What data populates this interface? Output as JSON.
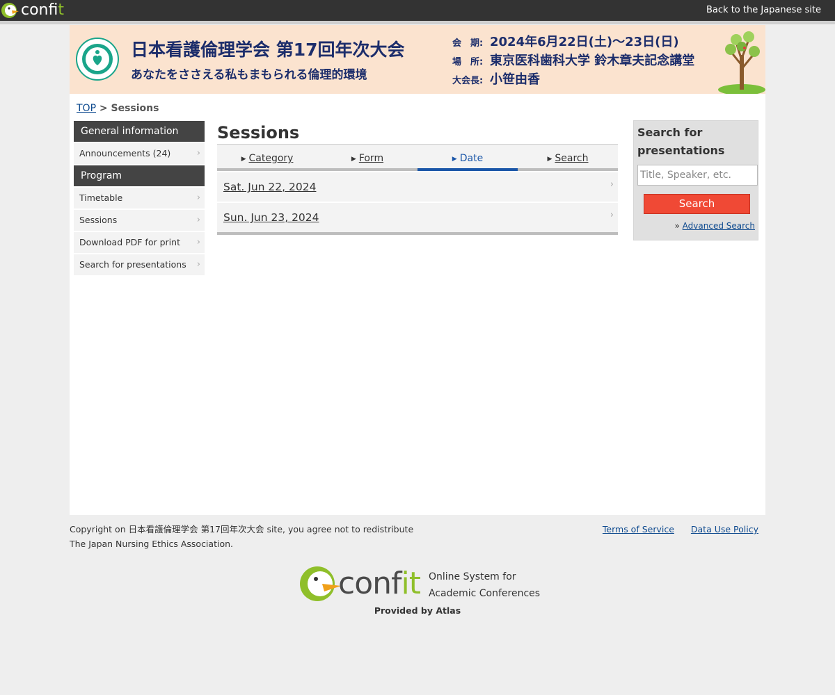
{
  "topbar": {
    "logo_text_prefix": "conf",
    "logo_text_suffix": "it",
    "back_link": "Back to the Japanese site"
  },
  "banner": {
    "title": "日本看護倫理学会 第17回年次大会",
    "subtitle": "あなたをささえる私もまもられる倫理的環境",
    "info": [
      {
        "label": "会　期:",
        "value": "2024年6月22日(土)〜23日(日)"
      },
      {
        "label": "場　所:",
        "value": "東京医科歯科大学 鈴木章夫記念講堂"
      },
      {
        "label": "大会長:",
        "value": "小笹由香"
      }
    ]
  },
  "breadcrumb": {
    "top": "TOP",
    "separator": " > ",
    "current": "Sessions"
  },
  "sidenav": {
    "sections": [
      {
        "heading": "General information",
        "items": [
          "Announcements (24)"
        ]
      },
      {
        "heading": "Program",
        "items": [
          "Timetable",
          "Sessions",
          "Download PDF for print",
          "Search for presentations"
        ]
      }
    ]
  },
  "content": {
    "title": "Sessions",
    "tabs": [
      {
        "label": "Category",
        "active": false
      },
      {
        "label": "Form",
        "active": false
      },
      {
        "label": "Date",
        "active": true
      },
      {
        "label": "Search",
        "active": false
      }
    ],
    "dates": [
      "Sat. Jun 22, 2024",
      "Sun. Jun 23, 2024"
    ]
  },
  "search": {
    "title": "Search for presentations",
    "placeholder": "Title, Speaker, etc.",
    "button": "Search",
    "advanced_prefix": "» ",
    "advanced": "Advanced Search"
  },
  "footer": {
    "copyright_line1": "Copyright on 日本看護倫理学会 第17回年次大会 site, you agree not to redistribute",
    "copyright_line2": "The Japan Nursing Ethics Association.",
    "terms": "Terms of Service",
    "data_policy": "Data Use Policy",
    "tagline_line1": "Online System for",
    "tagline_line2": "Academic Conferences",
    "provided_by": "Provided by Atlas"
  },
  "colors": {
    "topbar": "#333333",
    "banner_bg": "#fbe3cf",
    "banner_text": "#1c2d6b",
    "accent_blue": "#1a56a8",
    "search_button": "#f04935",
    "confit_green": "#8fbf2a"
  }
}
